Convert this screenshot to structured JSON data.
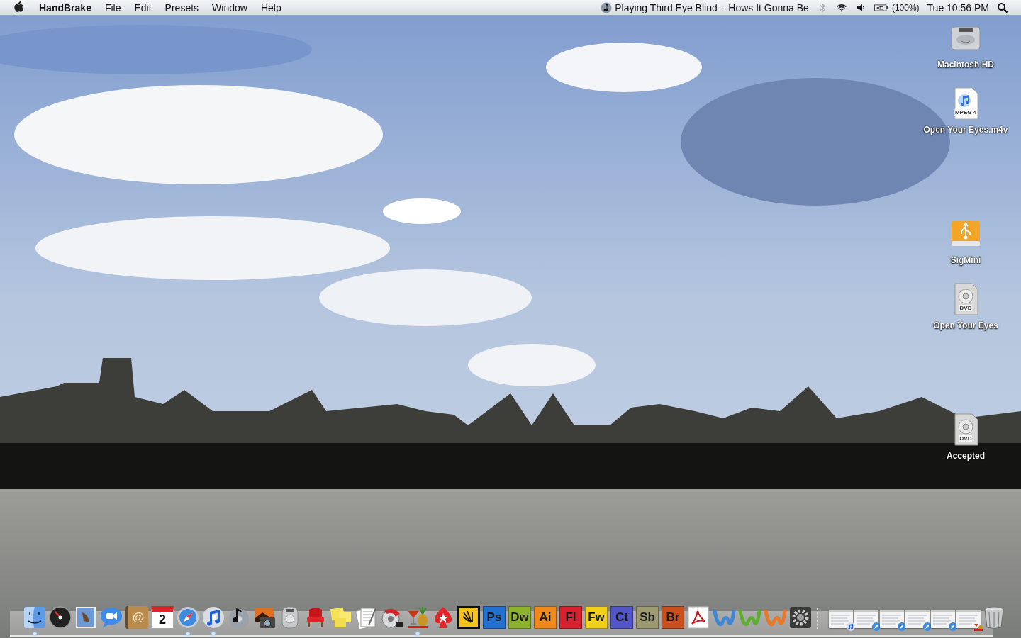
{
  "menu_bar": {
    "app_name": "HandBrake",
    "menus": [
      "File",
      "Edit",
      "Presets",
      "Window",
      "Help"
    ],
    "now_playing": "Playing Third Eye Blind – Hows It Gonna Be",
    "battery_percent": "(100%)",
    "clock": "Tue 10:56 PM"
  },
  "desktop_icons": [
    {
      "kind": "hard-drive",
      "label": "Macintosh HD"
    },
    {
      "kind": "movie-file",
      "label": "Open Your Eyes.m4v",
      "badge": "MPEG 4"
    },
    {
      "kind": "usb-drive",
      "label": "SigMini"
    },
    {
      "kind": "dvd",
      "label": "Open Your Eyes",
      "badge": "DVD"
    },
    {
      "kind": "dvd",
      "label": "Accepted",
      "badge": "DVD"
    }
  ],
  "dock": {
    "apps": [
      {
        "kind": "finder",
        "running": true
      },
      {
        "kind": "dashboard",
        "running": false
      },
      {
        "kind": "mail",
        "running": false
      },
      {
        "kind": "ichat",
        "running": false
      },
      {
        "kind": "book",
        "label": "@",
        "running": false
      },
      {
        "kind": "calendar",
        "label": "2",
        "running": false
      },
      {
        "kind": "compass",
        "running": true
      },
      {
        "kind": "music",
        "running": true
      },
      {
        "kind": "disc",
        "running": false
      },
      {
        "kind": "camera",
        "running": false
      },
      {
        "kind": "remote",
        "running": false
      },
      {
        "kind": "chair",
        "running": false
      },
      {
        "kind": "notes",
        "running": false
      },
      {
        "kind": "document",
        "running": false
      },
      {
        "kind": "saw",
        "running": false
      },
      {
        "kind": "cocktail",
        "running": true
      },
      {
        "kind": "spade",
        "running": false
      },
      {
        "kind": "fan",
        "running": false
      },
      {
        "kind": "tile",
        "label": "Ps",
        "color": "#2270cf",
        "running": false
      },
      {
        "kind": "tile",
        "label": "Dw",
        "color": "#8cb22e",
        "running": false
      },
      {
        "kind": "tile",
        "label": "Ai",
        "color": "#f0891b",
        "running": false
      },
      {
        "kind": "tile",
        "label": "Fl",
        "color": "#d6222f",
        "running": false
      },
      {
        "kind": "tile",
        "label": "Fw",
        "color": "#f1d01c",
        "running": false
      },
      {
        "kind": "tile",
        "label": "Ct",
        "color": "#5155c6",
        "running": false
      },
      {
        "kind": "tile",
        "label": "Sb",
        "color": "#9d9a72",
        "running": false
      },
      {
        "kind": "tile",
        "label": "Br",
        "color": "#c8501f",
        "running": false
      },
      {
        "kind": "pdf",
        "running": false
      },
      {
        "kind": "swoosh",
        "color": "#3f86d3",
        "running": false
      },
      {
        "kind": "swoosh",
        "color": "#5fae32",
        "running": false
      },
      {
        "kind": "swoosh",
        "color": "#e8782a",
        "running": false
      },
      {
        "kind": "gear",
        "running": false
      }
    ],
    "windows": [
      {
        "kind": "music"
      },
      {
        "kind": "compass"
      },
      {
        "kind": "compass"
      },
      {
        "kind": "compass"
      },
      {
        "kind": "compass"
      },
      {
        "kind": "cocktail"
      }
    ],
    "trash": {
      "kind": "trash"
    }
  }
}
